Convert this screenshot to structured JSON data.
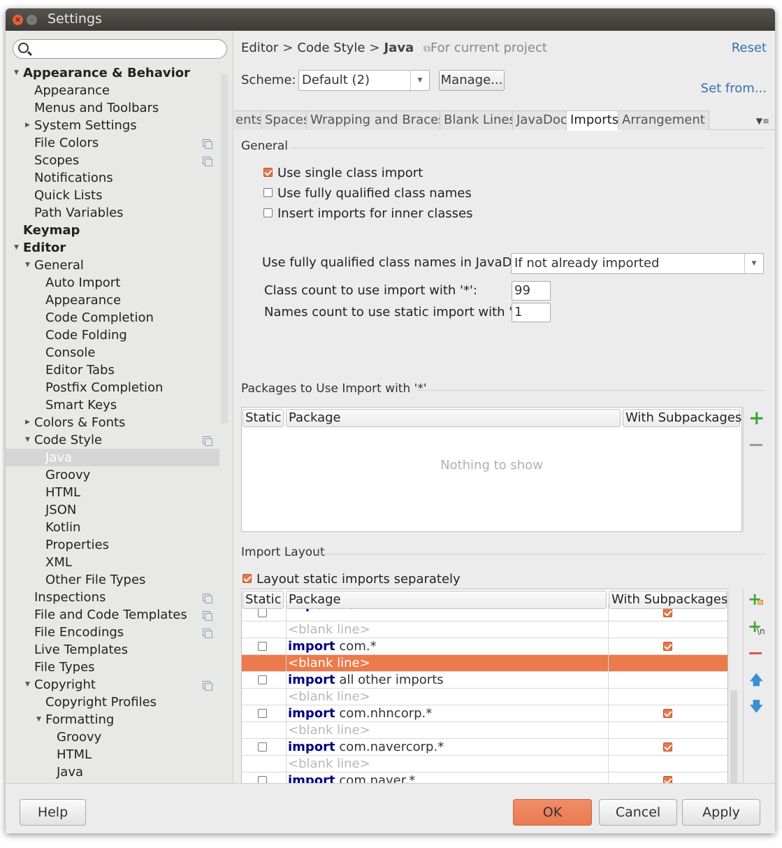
{
  "window": {
    "title": "Settings"
  },
  "search": {
    "placeholder": ""
  },
  "tree": [
    {
      "label": "Appearance & Behavior",
      "level": 0,
      "bold": true,
      "arrow": "down"
    },
    {
      "label": "Appearance",
      "level": 1
    },
    {
      "label": "Menus and Toolbars",
      "level": 1
    },
    {
      "label": "System Settings",
      "level": 1,
      "arrow": "right"
    },
    {
      "label": "File Colors",
      "level": 1,
      "copy": true
    },
    {
      "label": "Scopes",
      "level": 1,
      "copy": true
    },
    {
      "label": "Notifications",
      "level": 1
    },
    {
      "label": "Quick Lists",
      "level": 1
    },
    {
      "label": "Path Variables",
      "level": 1
    },
    {
      "label": "Keymap",
      "level": 0,
      "bold": true
    },
    {
      "label": "Editor",
      "level": 0,
      "bold": true,
      "arrow": "down"
    },
    {
      "label": "General",
      "level": 1,
      "arrow": "down"
    },
    {
      "label": "Auto Import",
      "level": 2
    },
    {
      "label": "Appearance",
      "level": 2
    },
    {
      "label": "Code Completion",
      "level": 2
    },
    {
      "label": "Code Folding",
      "level": 2
    },
    {
      "label": "Console",
      "level": 2
    },
    {
      "label": "Editor Tabs",
      "level": 2
    },
    {
      "label": "Postfix Completion",
      "level": 2
    },
    {
      "label": "Smart Keys",
      "level": 2
    },
    {
      "label": "Colors & Fonts",
      "level": 1,
      "arrow": "right"
    },
    {
      "label": "Code Style",
      "level": 1,
      "arrow": "down",
      "copy": true
    },
    {
      "label": "Java",
      "level": 2,
      "selected": true
    },
    {
      "label": "Groovy",
      "level": 2
    },
    {
      "label": "HTML",
      "level": 2
    },
    {
      "label": "JSON",
      "level": 2
    },
    {
      "label": "Kotlin",
      "level": 2
    },
    {
      "label": "Properties",
      "level": 2
    },
    {
      "label": "XML",
      "level": 2
    },
    {
      "label": "Other File Types",
      "level": 2
    },
    {
      "label": "Inspections",
      "level": 1,
      "copy": true
    },
    {
      "label": "File and Code Templates",
      "level": 1,
      "copy": true
    },
    {
      "label": "File Encodings",
      "level": 1,
      "copy": true
    },
    {
      "label": "Live Templates",
      "level": 1
    },
    {
      "label": "File Types",
      "level": 1
    },
    {
      "label": "Copyright",
      "level": 1,
      "arrow": "down",
      "copy": true
    },
    {
      "label": "Copyright Profiles",
      "level": 2
    },
    {
      "label": "Formatting",
      "level": 2,
      "arrow": "down"
    },
    {
      "label": "Groovy",
      "level": 3
    },
    {
      "label": "HTML",
      "level": 3
    },
    {
      "label": "Java",
      "level": 3
    }
  ],
  "breadcrumb": {
    "items": [
      "Editor",
      "Code Style",
      "Java"
    ],
    "sep": ">",
    "project": "For current project"
  },
  "header": {
    "reset": "Reset",
    "scheme_label": "Scheme:",
    "scheme_value": "Default (2)",
    "manage": "Manage...",
    "set_from": "Set from..."
  },
  "tabs": [
    "ents",
    "Spaces",
    "Wrapping and Braces",
    "Blank Lines",
    "JavaDoc",
    "Imports",
    "Arrangement"
  ],
  "active_tab": "Imports",
  "general": {
    "title": "General",
    "single_class": "Use single class import",
    "fully_qualified": "Use fully qualified class names",
    "inner_classes": "Insert imports for inner classes",
    "javadoc_label": "Use fully qualified class names in JavaDoc:",
    "javadoc_value": "If not already imported",
    "class_count_label": "Class count to use import with '*':",
    "class_count_value": "99",
    "names_count_label": "Names count to use static import with '*':",
    "names_count_value": "1"
  },
  "packages": {
    "title": "Packages to Use Import with '*'",
    "col_static": "Static",
    "col_package": "Package",
    "col_sub": "With Subpackages",
    "empty": "Nothing to show"
  },
  "layout": {
    "title": "Import Layout",
    "static_sep": "Layout static imports separately",
    "col_static": "Static",
    "col_package": "Package",
    "col_sub": "With Subpackages",
    "rows": [
      {
        "kw": "import",
        "text": "net.*",
        "sub": true,
        "partial": true
      },
      {
        "blank": "<blank line>"
      },
      {
        "kw": "import",
        "text": "com.*",
        "sub": true
      },
      {
        "blank": "<blank line>",
        "selected": true
      },
      {
        "kw": "import",
        "text": "all other imports"
      },
      {
        "blank": "<blank line>"
      },
      {
        "kw": "import",
        "text": "com.nhncorp.*",
        "sub": true
      },
      {
        "blank": "<blank line>"
      },
      {
        "kw": "import",
        "text": "com.navercorp.*",
        "sub": true
      },
      {
        "blank": "<blank line>"
      },
      {
        "kw": "import",
        "text": "com.naver.*",
        "sub": true
      }
    ]
  },
  "footer": {
    "help": "Help",
    "ok": "OK",
    "cancel": "Cancel",
    "apply": "Apply"
  }
}
